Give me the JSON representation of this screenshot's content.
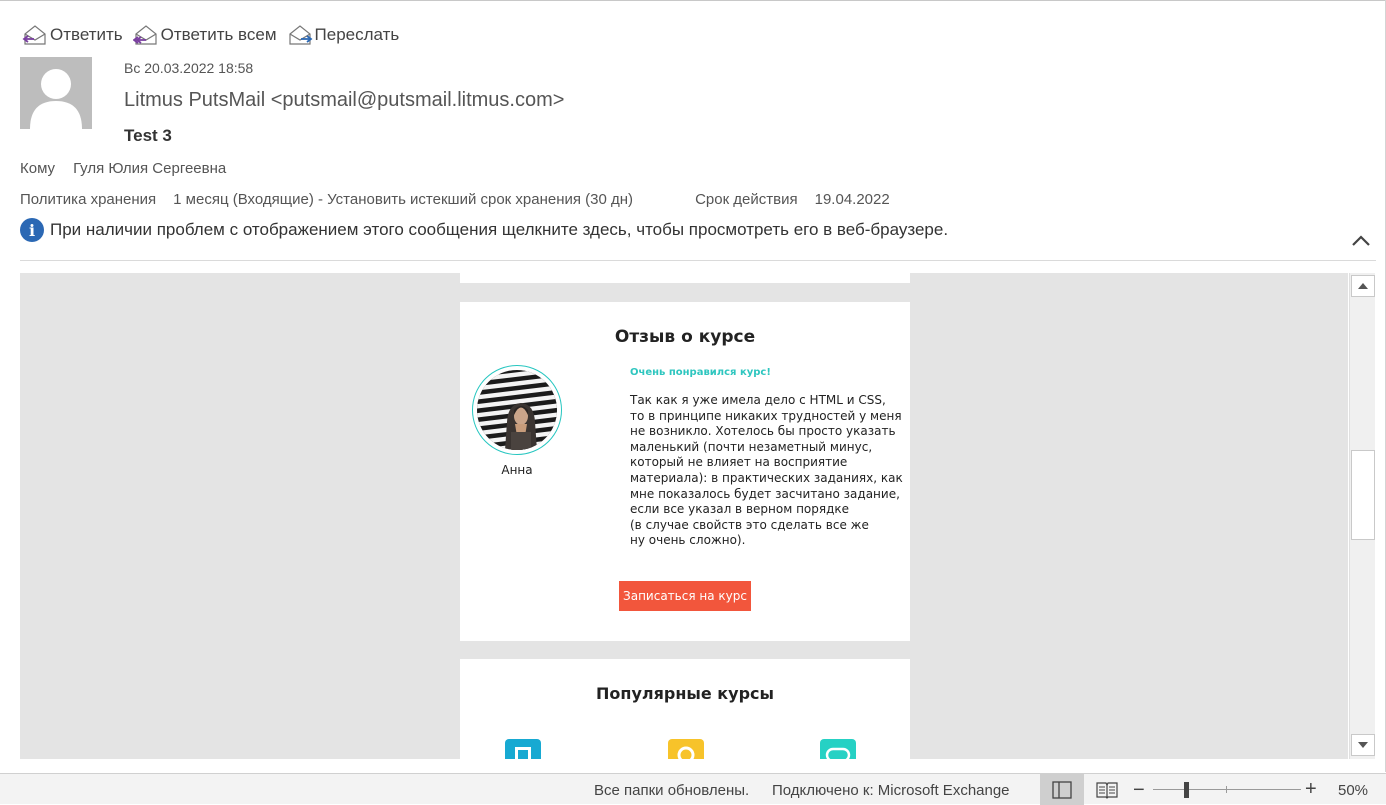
{
  "toolbar": {
    "reply": "Ответить",
    "reply_all": "Ответить всем",
    "forward": "Переслать"
  },
  "message": {
    "date": "Вс 20.03.2022 18:58",
    "from": "Litmus PutsMail <putsmail@putsmail.litmus.com>",
    "subject": "Test 3",
    "to_label": "Кому",
    "to_value": "Гуля Юлия Сергеевна",
    "policy_label": "Политика хранения",
    "policy_value": "1 месяц (Входящие) - Установить истекший срок хранения (30 дн)",
    "expires_label": "Срок действия",
    "expires_value": "19.04.2022",
    "info_text": "При наличии проблем с отображением этого сообщения щелкните здесь, чтобы просмотреть его в веб-браузере."
  },
  "email_body": {
    "review": {
      "title": "Отзыв о курсе",
      "reviewer_name": "Анна",
      "headline": "Очень понравился курс!",
      "text": "Так как я уже имела дело с HTML и CSS,\nто в принципе никаких трудностей у меня\nне возникло. Хотелось бы просто указать\nмаленький (почти незаметный минус,\nкоторый не влияет на восприятие\nматериала): в практических заданиях, как\nмне показалось будет засчитано задание,\nесли все указал в верном порядке\n(в случае свойств это сделать все же\nну очень сложно).",
      "button": "Записаться на курс",
      "button_color": "#f2563c",
      "accent_color": "#2ec6bf"
    },
    "popular": {
      "title": "Популярные курсы",
      "icon_colors": [
        "#17a9d2",
        "#f7c32a",
        "#26d1c4"
      ]
    }
  },
  "statusbar": {
    "folders": "Все папки обновлены.",
    "connection": "Подключено к: Microsoft Exchange",
    "zoom": "50%",
    "zoom_percent": 50
  }
}
